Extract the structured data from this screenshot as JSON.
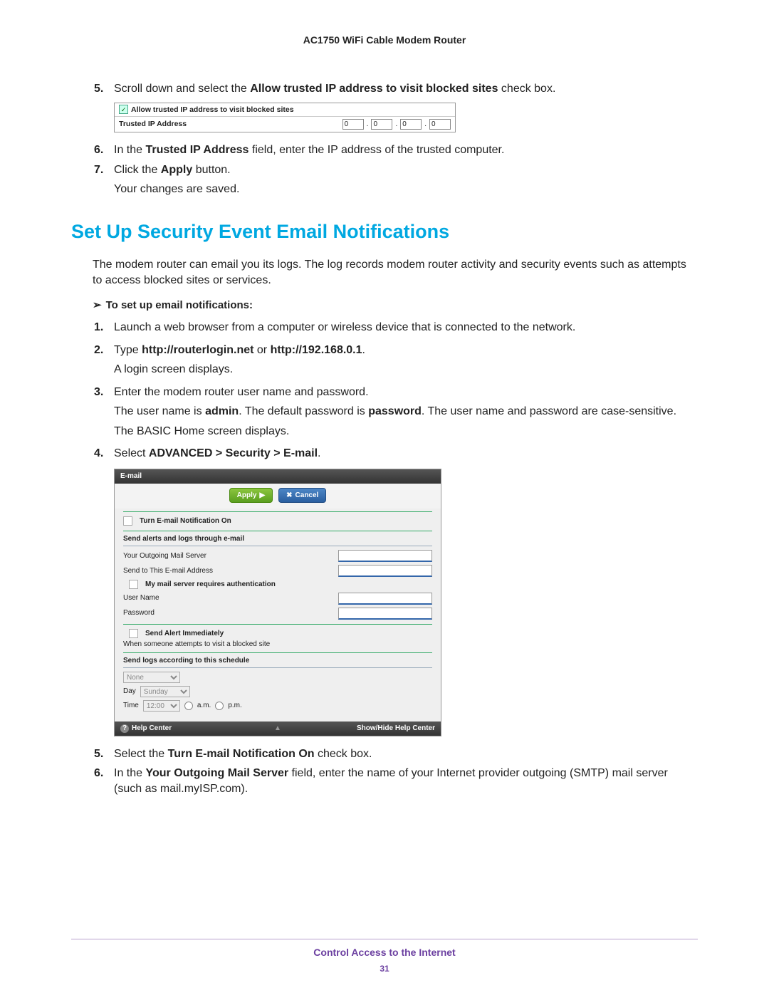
{
  "header": {
    "title": "AC1750 WiFi Cable Modem Router"
  },
  "top_steps": {
    "s5": {
      "num": "5.",
      "pre": "Scroll down and select the ",
      "bold": "Allow trusted IP address to visit blocked sites",
      "post": " check box."
    },
    "s6": {
      "num": "6.",
      "pre": "In the ",
      "bold": "Trusted IP Address",
      "post": " field, enter the IP address of the trusted computer."
    },
    "s7": {
      "num": "7.",
      "pre": "Click the ",
      "bold": "Apply",
      "post": " button.",
      "result": "Your changes are saved."
    }
  },
  "shot1": {
    "checkbox_label": "Allow trusted IP address to visit blocked sites",
    "row_label": "Trusted IP Address",
    "octet": "0",
    "dot": "."
  },
  "section_heading": "Set Up Security Event Email Notifications",
  "intro": "The modem router can email you its logs. The log records modem router activity and security events such as attempts to access blocked sites or services.",
  "task_lead": {
    "arrow": "➢",
    "text": "To set up email notifications:"
  },
  "steps2": {
    "s1": {
      "num": "1.",
      "text": "Launch a web browser from a computer or wireless device that is connected to the network."
    },
    "s2": {
      "num": "2.",
      "pre": "Type ",
      "bold1": "http://routerlogin.net",
      "mid": " or ",
      "bold2": "http://192.168.0.1",
      "post": ".",
      "result": "A login screen displays."
    },
    "s3": {
      "num": "3.",
      "text": "Enter the modem router user name and password.",
      "para2_pre": "The user name is ",
      "para2_b1": "admin",
      "para2_mid": ". The default password is ",
      "para2_b2": "password",
      "para2_post": ". The user name and password are case-sensitive.",
      "para3": "The BASIC Home screen displays."
    },
    "s4": {
      "num": "4.",
      "pre": "Select ",
      "bold": "ADVANCED > Security > E-mail",
      "post": "."
    },
    "s5": {
      "num": "5.",
      "pre": "Select the ",
      "bold": "Turn E-mail Notification On",
      "post": " check box."
    },
    "s6": {
      "num": "6.",
      "pre": "In the ",
      "bold": "Your Outgoing Mail Server",
      "post": " field, enter the name of your Internet provider outgoing (SMTP) mail server (such as mail.myISP.com)."
    }
  },
  "shot2": {
    "title": "E-mail",
    "apply": "Apply",
    "apply_glyph": "▶",
    "cancel_glyph": "✖",
    "cancel": "Cancel",
    "turn_on": "Turn E-mail Notification On",
    "send_alerts_header": "Send alerts and logs through e-mail",
    "out_server": "Your Outgoing Mail Server",
    "send_to": "Send to This E-mail Address",
    "auth": "My mail server requires authentication",
    "username": "User Name",
    "password": "Password",
    "send_alert_imm": "Send Alert Immediately",
    "when_block": "When someone attempts to visit a blocked site",
    "schedule_header": "Send logs according to this schedule",
    "schedule_none": "None",
    "day_label": "Day",
    "day_value": "Sunday",
    "time_label": "Time",
    "time_value": "12:00",
    "am": "a.m.",
    "pm": "p.m.",
    "help_left_glyph": "?",
    "help_left": "Help Center",
    "help_mid_glyph": "▲",
    "help_right": "Show/Hide Help Center"
  },
  "footer": {
    "title": "Control Access to the Internet",
    "page": "31"
  }
}
